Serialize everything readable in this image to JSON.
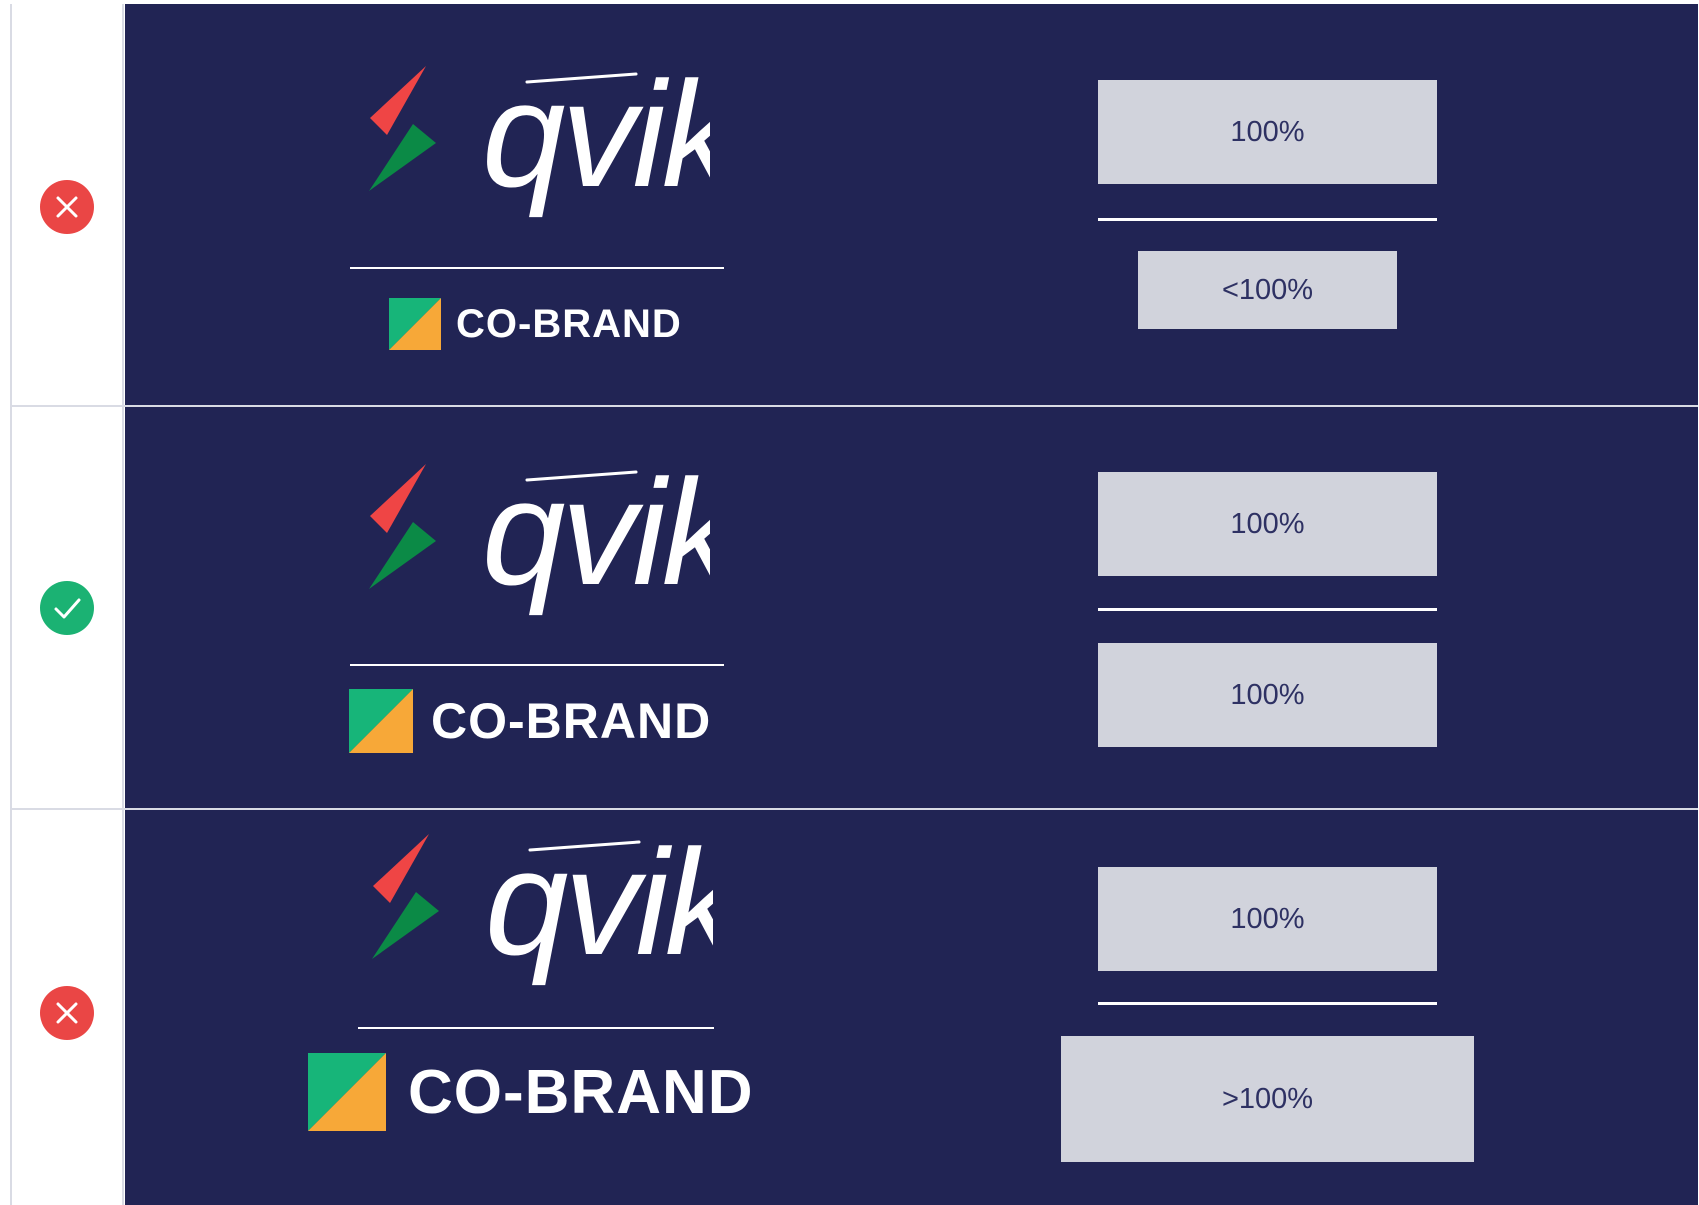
{
  "rows": [
    {
      "status": "incorrect",
      "status_icon": "x-icon",
      "status_color": "#ea4645",
      "logo_text": "qvik",
      "cobrand_label": "CO-BRAND",
      "top_box": "100%",
      "bottom_box": "<100%"
    },
    {
      "status": "correct",
      "status_icon": "check-icon",
      "status_color": "#1bb273",
      "logo_text": "qvik",
      "cobrand_label": "CO-BRAND",
      "top_box": "100%",
      "bottom_box": "100%"
    },
    {
      "status": "incorrect",
      "status_icon": "x-icon",
      "status_color": "#ea4645",
      "logo_text": "qvik",
      "cobrand_label": "CO-BRAND",
      "top_box": "100%",
      "bottom_box": ">100%"
    }
  ],
  "colors": {
    "panel": "#212454",
    "box": "#d1d3dc",
    "box_text": "#2e3163",
    "bolt_red": "#ef4545",
    "bolt_green": "#0b8a46",
    "cobrand_green": "#17b579",
    "cobrand_orange": "#f7a838"
  }
}
